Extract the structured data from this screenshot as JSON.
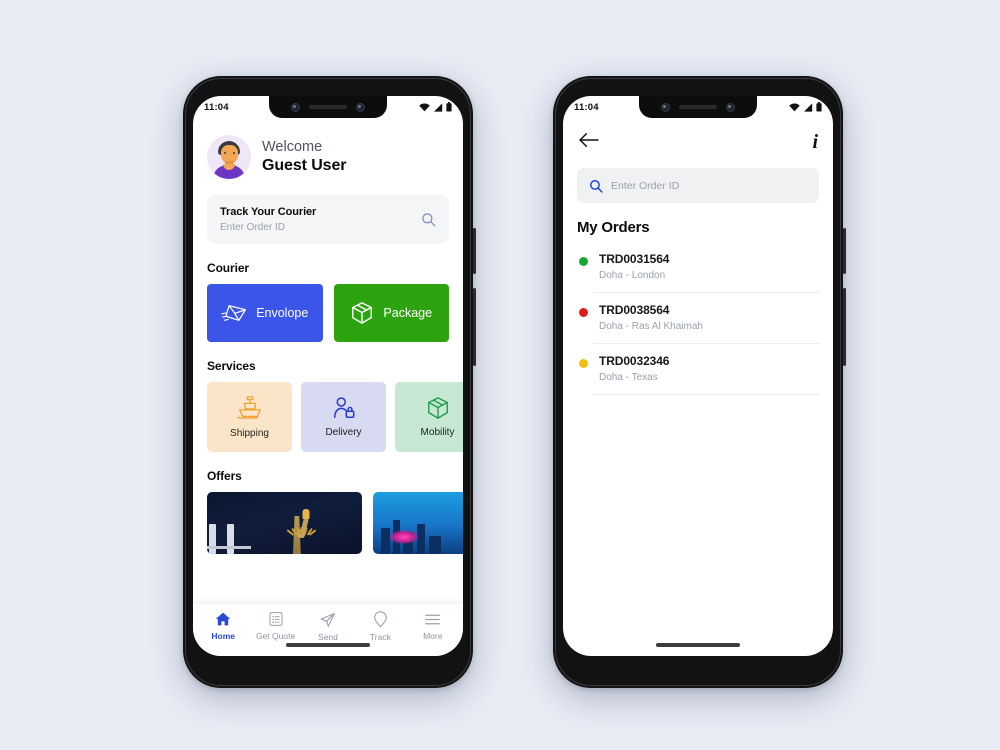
{
  "canvas": {
    "background": "#e8ecf5"
  },
  "phone1": {
    "status": {
      "time": "11:04",
      "icons": [
        "wifi-icon",
        "signal-icon",
        "battery-icon"
      ]
    },
    "header": {
      "avatar": "user-avatar",
      "greeting": "Welcome",
      "username": "Guest User"
    },
    "track_card": {
      "title": "Track Your Courier",
      "placeholder": "Enter Order ID",
      "icon": "search-icon"
    },
    "courier": {
      "title": "Courier",
      "options": [
        {
          "label": "Envolope",
          "color": "#3B55E8",
          "icon": "envelope-icon"
        },
        {
          "label": "Package",
          "color": "#2DA310",
          "icon": "box-icon"
        }
      ]
    },
    "services": {
      "title": "Services",
      "items": [
        {
          "label": "Shipping",
          "bg": "#FBE5C8",
          "accent": "#F0A132",
          "icon": "ship-icon"
        },
        {
          "label": "Delivery",
          "bg": "#D7DAF1",
          "accent": "#2540CF",
          "icon": "person-lock-icon"
        },
        {
          "label": "Mobility",
          "bg": "#C6E8D3",
          "accent": "#1E9B4E",
          "icon": "box-outline-icon"
        }
      ]
    },
    "offers": {
      "title": "Offers",
      "cards": [
        {
          "name": "statue-of-liberty-offer"
        },
        {
          "name": "city-skyline-offer"
        }
      ]
    },
    "bottom_nav": [
      {
        "label": "Home",
        "icon": "home-icon",
        "active": true
      },
      {
        "label": "Get Quote",
        "icon": "document-list-icon",
        "active": false
      },
      {
        "label": "Send",
        "icon": "paper-plane-icon",
        "active": false
      },
      {
        "label": "Track",
        "icon": "location-pin-icon",
        "active": false
      },
      {
        "label": "More",
        "icon": "hamburger-menu-icon",
        "active": false
      }
    ],
    "accent_color": "#2747D6"
  },
  "phone2": {
    "status": {
      "time": "11:04",
      "icons": [
        "wifi-icon",
        "signal-icon",
        "battery-icon"
      ]
    },
    "top_bar": {
      "back_icon": "back-arrow-icon",
      "info_icon": "info-icon",
      "info_glyph": "i"
    },
    "search": {
      "placeholder": "Enter Order ID",
      "icon": "search-icon"
    },
    "orders_title": "My Orders",
    "orders": [
      {
        "id": "TRD0031564",
        "route": "Doha - London",
        "status_color": "#16A637"
      },
      {
        "id": "TRD0038564",
        "route": "Doha - Ras Al Khaimah",
        "status_color": "#E01B1B"
      },
      {
        "id": "TRD0032346",
        "route": "Doha - Texas",
        "status_color": "#F2C010"
      }
    ]
  }
}
